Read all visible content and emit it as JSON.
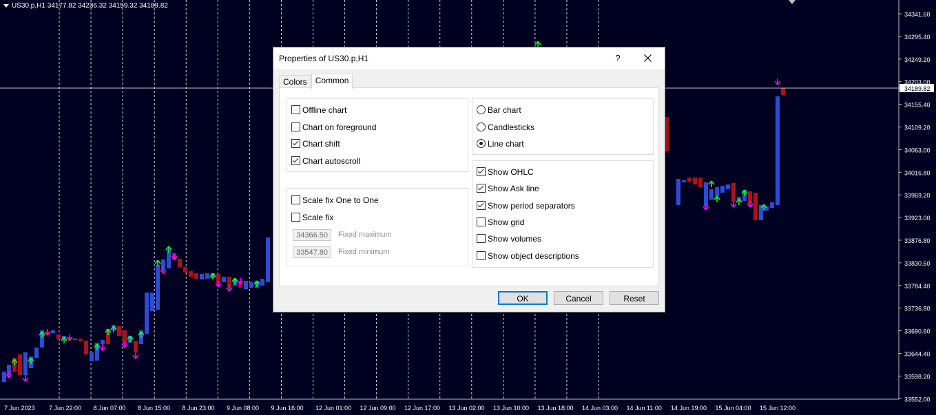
{
  "chart": {
    "header": "US30.p,H1  34177.82 34236.32 34159.32 34189.82",
    "price_labels": [
      "34341.60",
      "34295.40",
      "34249.20",
      "34203.00",
      "34155.40",
      "34109.20",
      "34063.00",
      "34016.80",
      "33969.20",
      "33923.00",
      "33876.80",
      "33830.60",
      "33784.40",
      "33736.80",
      "33690.60",
      "33644.40",
      "33598.20",
      "33552.00"
    ],
    "current_price": "34189.82",
    "time_labels": [
      "7 Jun 2023",
      "7 Jun 22:00",
      "8 Jun 07:00",
      "8 Jun 15:00",
      "8 Jun 23:00",
      "9 Jun 08:00",
      "9 Jun 16:00",
      "12 Jun 01:00",
      "12 Jun 09:00",
      "12 Jun 17:00",
      "13 Jun 02:00",
      "13 Jun 10:00",
      "13 Jun 18:00",
      "14 Jun 03:00",
      "14 Jun 11:00",
      "14 Jun 19:00",
      "15 Jun 04:00",
      "15 Jun 12:00"
    ],
    "colors": {
      "background": "#000020",
      "bull": "#2b4cd6",
      "bear": "#b0101a",
      "up_arrow": "#00ff40",
      "down_arrow": "#ff00ff",
      "grid": "#ffffff"
    }
  },
  "dialog": {
    "title": "Properties of US30.p,H1",
    "help": "?",
    "tabs": [
      {
        "label": "Colors",
        "active": false
      },
      {
        "label": "Common",
        "active": true
      }
    ],
    "options_left": [
      {
        "label": "Offline chart",
        "checked": false
      },
      {
        "label": "Chart on foreground",
        "checked": false
      },
      {
        "label": "Chart shift",
        "checked": true
      },
      {
        "label": "Chart autoscroll",
        "checked": true
      }
    ],
    "scale": [
      {
        "label": "Scale fix One to One",
        "checked": false
      },
      {
        "label": "Scale fix",
        "checked": false
      }
    ],
    "fixed_max": {
      "value": "34366.50",
      "label": "Fixed maximum"
    },
    "fixed_min": {
      "value": "33547.80",
      "label": "Fixed minimum"
    },
    "chart_types": [
      {
        "label": "Bar chart",
        "checked": false
      },
      {
        "label": "Candlesticks",
        "checked": false
      },
      {
        "label": "Line chart",
        "checked": true
      }
    ],
    "show_options": [
      {
        "label": "Show OHLC",
        "checked": true
      },
      {
        "label": "Show Ask line",
        "checked": true
      },
      {
        "label": "Show period separators",
        "checked": true
      },
      {
        "label": "Show grid",
        "checked": false
      },
      {
        "label": "Show volumes",
        "checked": false
      },
      {
        "label": "Show object descriptions",
        "checked": false
      }
    ],
    "buttons": {
      "ok": "OK",
      "cancel": "Cancel",
      "reset": "Reset"
    }
  }
}
